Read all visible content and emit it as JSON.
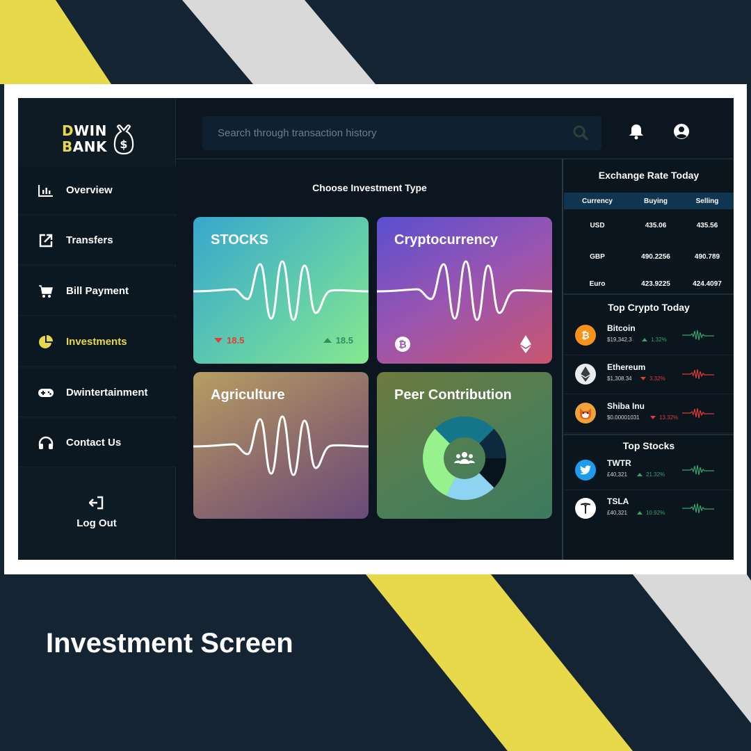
{
  "brand": {
    "line1_first": "D",
    "line1_rest": "WIN",
    "line2_first": "B",
    "line2_rest": "ANK",
    "bag_symbol": "$",
    "accent": "#e8d94a"
  },
  "sidebar": {
    "items": [
      {
        "label": "Overview",
        "icon": "bar-chart-icon"
      },
      {
        "label": "Transfers",
        "icon": "external-link-icon"
      },
      {
        "label": "Bill Payment",
        "icon": "cart-icon"
      },
      {
        "label": "Investments",
        "icon": "pie-chart-icon",
        "active": true
      },
      {
        "label": "Dwintertainment",
        "icon": "gamepad-icon"
      },
      {
        "label": "Contact Us",
        "icon": "headphones-icon"
      }
    ],
    "logout_label": "Log Out"
  },
  "header": {
    "search_placeholder": "Search through transaction history"
  },
  "main": {
    "title": "Choose Investment Type",
    "cards": [
      {
        "title": "STOCKS",
        "down_value": "18.5",
        "up_value": "18.5"
      },
      {
        "title": "Cryptocurrency"
      },
      {
        "title": "Agriculture"
      },
      {
        "title": "Peer Contribution"
      }
    ]
  },
  "exchange": {
    "title": "Exchange Rate Today",
    "headers": [
      "Currency",
      "Buying",
      "Selling"
    ],
    "rows": [
      {
        "currency": "USD",
        "buying": "435.06",
        "selling": "435.56"
      },
      {
        "currency": "GBP",
        "buying": "490.2256",
        "selling": "490.789"
      },
      {
        "currency": "Euro",
        "buying": "423.9225",
        "selling": "424.4097"
      }
    ]
  },
  "top_crypto": {
    "title": "Top Crypto Today",
    "items": [
      {
        "name": "Bitcoin",
        "price": "$19,342.3",
        "change": "1.32%",
        "direction": "up",
        "icon": "bitcoin-icon"
      },
      {
        "name": "Ethereum",
        "price": "$1,308.34",
        "change": "3.32%",
        "direction": "down",
        "icon": "ethereum-icon"
      },
      {
        "name": "Shiba Inu",
        "price": "$0.00001031",
        "change": "13.32%",
        "direction": "down",
        "icon": "shiba-icon"
      }
    ]
  },
  "top_stocks": {
    "title": "Top Stocks",
    "items": [
      {
        "name": "TWTR",
        "price": "£40,321",
        "change": "21.32%",
        "direction": "up",
        "icon": "twitter-icon"
      },
      {
        "name": "TSLA",
        "price": "£40,321",
        "change": "10.92%",
        "direction": "up",
        "icon": "tesla-icon"
      }
    ]
  },
  "caption": "Investment Screen",
  "colors": {
    "up": "#38a36b",
    "down": "#e03a3a",
    "page_bg": "#142433",
    "stripe_yellow": "#e8d94a",
    "stripe_gray": "#d9d9d9"
  }
}
